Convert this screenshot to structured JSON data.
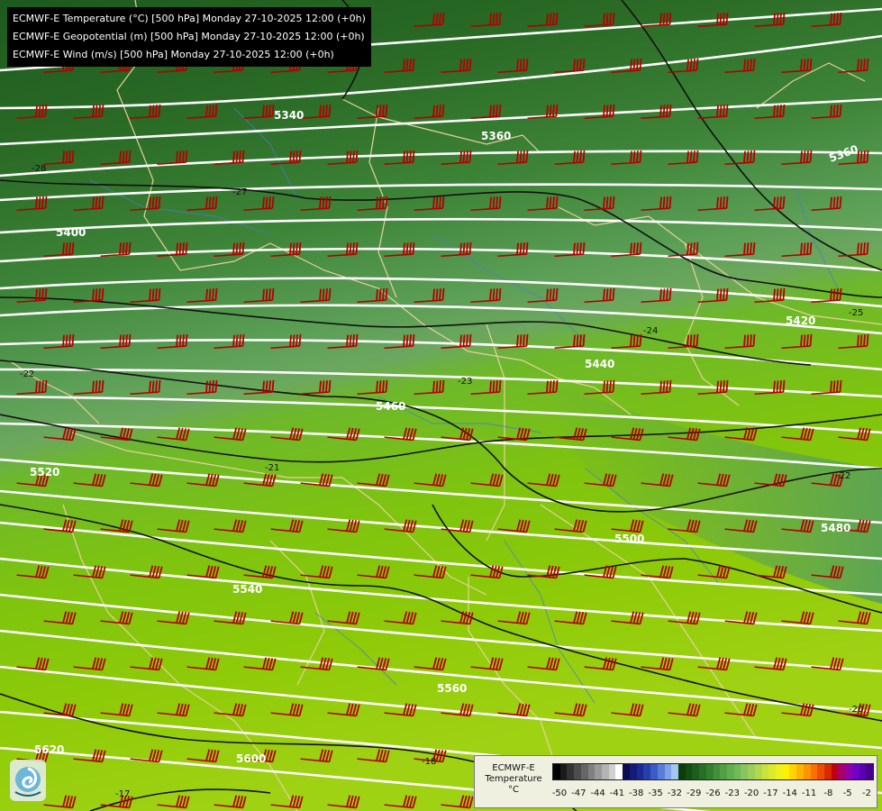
{
  "header": {
    "lines": [
      "ECMWF-E Temperature (°C) [500 hPa] Monday 27-10-2025 12:00 (+0h)",
      "ECMWF-E Geopotential (m) [500 hPa] Monday 27-10-2025 12:00 (+0h)",
      "ECMWF-E Wind (m/s) [500 hPa] Monday 27-10-2025 12:00 (+0h)"
    ]
  },
  "geopotential_labels": [
    "5340",
    "5360",
    "5360",
    "5400",
    "5420",
    "5440",
    "5460",
    "5480",
    "5500",
    "5520",
    "5540",
    "5560",
    "5600",
    "5620"
  ],
  "temperature_labels": [
    "-28",
    "-27",
    "-22",
    "-21",
    "-22",
    "-25",
    "-24",
    "-23",
    "-20",
    "-18",
    "-17"
  ],
  "legend": {
    "title_lines": [
      "ECMWF-E",
      "Temperature",
      "°C"
    ],
    "ticks": [
      "-50",
      "-47",
      "-44",
      "-41",
      "-38",
      "-35",
      "-32",
      "-29",
      "-26",
      "-23",
      "-20",
      "-17",
      "-14",
      "-11",
      "-8",
      "-5",
      "-2"
    ],
    "colors": [
      "#000000",
      "#1a1a1a",
      "#333333",
      "#4d4d4d",
      "#666666",
      "#808080",
      "#999999",
      "#b3b3b3",
      "#d0d0d0",
      "#ffffff",
      "#0a0a55",
      "#131a78",
      "#1a2a92",
      "#2340ac",
      "#3a5cc4",
      "#5a7ed8",
      "#7ea2e8",
      "#a6c6f2",
      "#0a3d0a",
      "#134d13",
      "#1d5e1d",
      "#276f25",
      "#33802e",
      "#429038",
      "#52a043",
      "#62ad4e",
      "#74b958",
      "#88c55f",
      "#9ccf5a",
      "#b2d94c",
      "#c8e23c",
      "#dcea2c",
      "#eef21c",
      "#fff000",
      "#ffd400",
      "#ffb400",
      "#ff9400",
      "#ff7000",
      "#f04c00",
      "#d82a00",
      "#c00010",
      "#a8006a",
      "#9000a8",
      "#7000c8",
      "#5a00b0",
      "#480090"
    ]
  },
  "colors": {
    "barb": "#b30000",
    "barb_cold": "#c9a0d8",
    "isohypse": "#ffffff",
    "isotherm": "#111111",
    "border": "#e6d29a",
    "river": "#4a7ad0"
  }
}
